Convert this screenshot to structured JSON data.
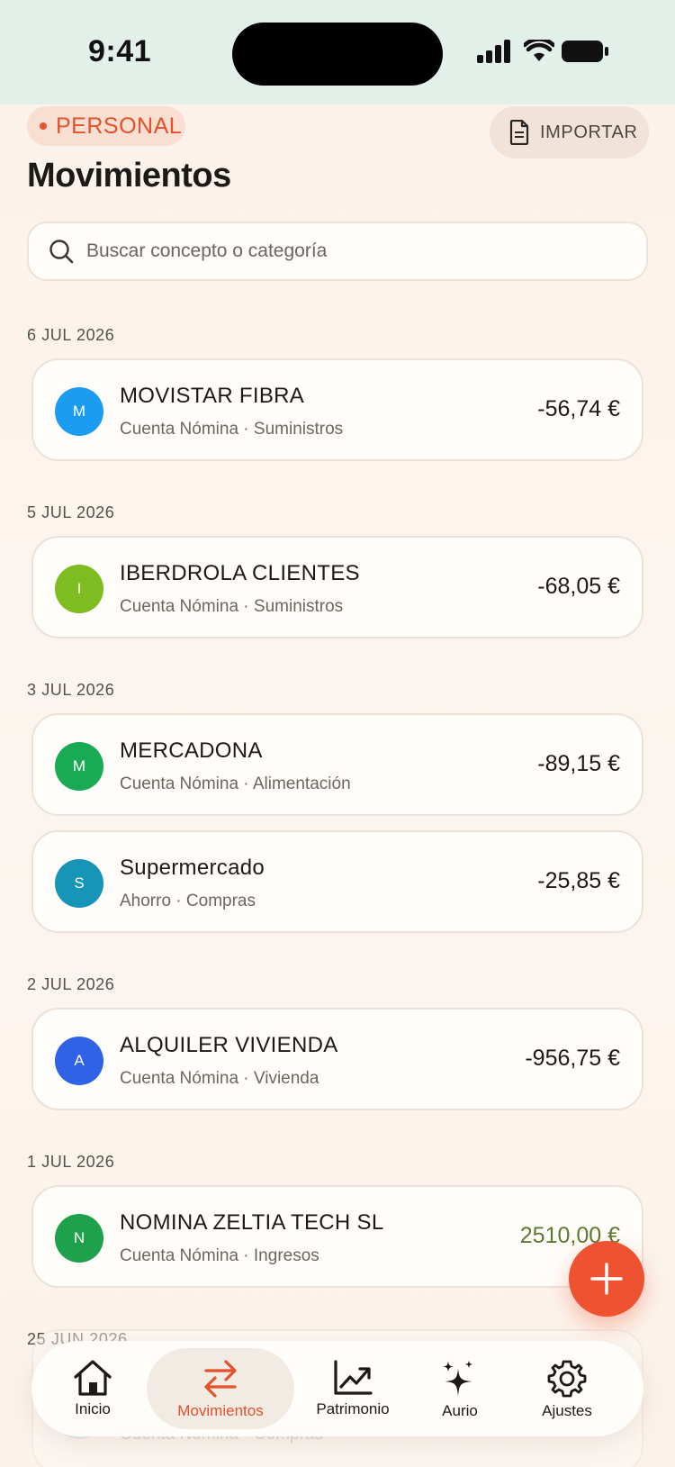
{
  "status_bar": {
    "time": "9:41"
  },
  "header": {
    "profile_chip": "PERSONAL",
    "import_label": "IMPORTAR",
    "title": "Movimientos"
  },
  "search": {
    "placeholder": "Buscar concepto o categoría"
  },
  "groups": [
    {
      "date": "6 JUL 2026",
      "items": [
        {
          "initial": "M",
          "title": "MOVISTAR FIBRA",
          "subtitle": "Cuenta Nómina · Suministros",
          "amount": "-56,74 €",
          "color": "#1b9cf0"
        }
      ]
    },
    {
      "date": "5 JUL 2026",
      "items": [
        {
          "initial": "I",
          "title": "IBERDROLA CLIENTES",
          "subtitle": "Cuenta Nómina · Suministros",
          "amount": "-68,05 €",
          "color": "#7ebc1f"
        }
      ]
    },
    {
      "date": "3 JUL 2026",
      "items": [
        {
          "initial": "M",
          "title": "MERCADONA",
          "subtitle": "Cuenta Nómina · Alimentación",
          "amount": "-89,15 €",
          "color": "#1aaa55"
        },
        {
          "initial": "S",
          "title": "Supermercado",
          "subtitle": "Ahorro · Compras",
          "amount": "-25,85 €",
          "color": "#1794b8"
        }
      ]
    },
    {
      "date": "2 JUL 2026",
      "items": [
        {
          "initial": "A",
          "title": "ALQUILER VIVIENDA",
          "subtitle": "Cuenta Nómina · Vivienda",
          "amount": "-956,75 €",
          "color": "#2f62e6"
        }
      ]
    },
    {
      "date": "1 JUL 2026",
      "items": [
        {
          "initial": "N",
          "title": "NOMINA ZELTIA TECH SL",
          "subtitle": "Cuenta Nómina · Ingresos",
          "amount": "2510,00 €",
          "color": "#1da14c",
          "positive": true
        }
      ]
    },
    {
      "date": "25 JUN 2026",
      "items": [
        {
          "subtitle": "Cuenta Nómina · Compras"
        }
      ]
    }
  ],
  "tabbar": {
    "tabs": [
      {
        "label": "Inicio",
        "icon": "home-icon"
      },
      {
        "label": "Movimientos",
        "icon": "transfer-arrows-icon",
        "active": true
      },
      {
        "label": "Patrimonio",
        "icon": "chart-trend-icon"
      },
      {
        "label": "Aurio",
        "icon": "sparkles-icon"
      },
      {
        "label": "Ajustes",
        "icon": "gear-icon"
      }
    ]
  },
  "colors": {
    "accent": "#e4512a",
    "fab": "#ef5230",
    "positive": "#5b7a2e"
  }
}
